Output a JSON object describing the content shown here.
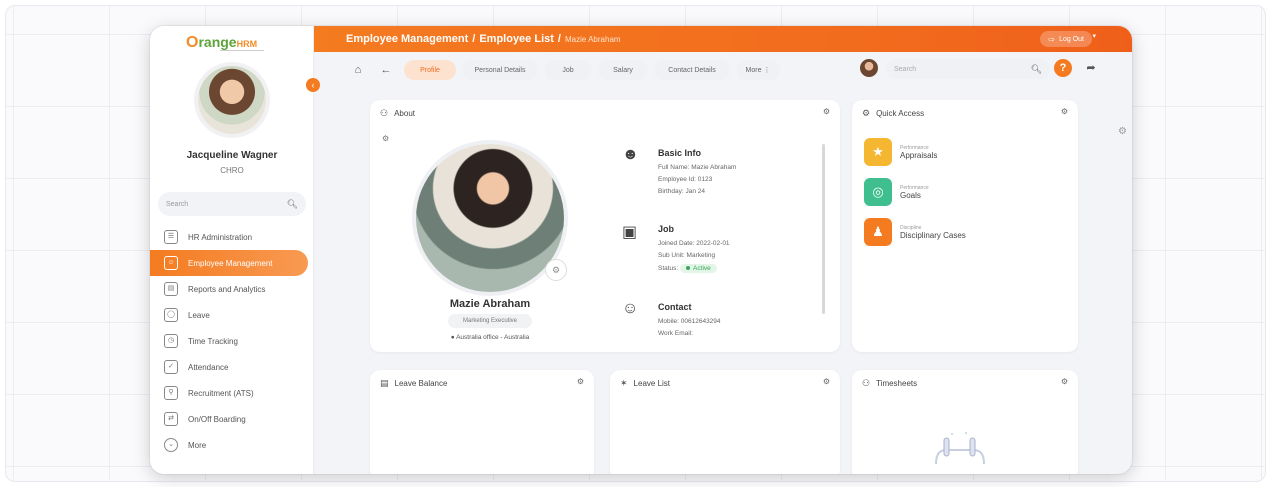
{
  "colors": {
    "accent": "#f47b20",
    "active_status": "#3ba55d"
  },
  "logo": {
    "brand_o": "O",
    "brand_rest": "range",
    "brand_hrm": "HRM"
  },
  "sidebar": {
    "user_name": "Jacqueline Wagner",
    "user_role": "CHRO",
    "search_placeholder": "Search",
    "items": [
      {
        "label": "HR Administration",
        "icon": "admin-icon"
      },
      {
        "label": "Employee Management",
        "icon": "people-icon",
        "active": true
      },
      {
        "label": "Reports and Analytics",
        "icon": "report-icon"
      },
      {
        "label": "Leave",
        "icon": "leave-icon"
      },
      {
        "label": "Time Tracking",
        "icon": "time-icon"
      },
      {
        "label": "Attendance",
        "icon": "attendance-icon"
      },
      {
        "label": "Recruitment (ATS)",
        "icon": "recruitment-icon"
      },
      {
        "label": "On/Off Boarding",
        "icon": "boarding-icon"
      },
      {
        "label": "More",
        "icon": "chevron-down-icon"
      }
    ]
  },
  "header": {
    "breadcrumb_1": "Employee Management",
    "breadcrumb_2": "Employee List",
    "breadcrumb_3": "Mazie Abraham",
    "logout_label": "Log Out"
  },
  "tabs": [
    {
      "label": "Profile",
      "active": true
    },
    {
      "label": "Personal Details"
    },
    {
      "label": "Job"
    },
    {
      "label": "Salary"
    },
    {
      "label": "Contact Details"
    },
    {
      "label": "More"
    }
  ],
  "top_search_placeholder": "Search",
  "about": {
    "title": "About",
    "name": "Mazie Abraham",
    "job_title": "Marketing Executive",
    "location": "Australia office - Australia",
    "basic_info": {
      "heading": "Basic Info",
      "full_name": "Full Name: Mazie Abraham",
      "employee_id": "Employee Id: 0123",
      "birthday": "Birthday: Jan 24"
    },
    "job": {
      "heading": "Job",
      "joined": "Joined Date: 2022-02-01",
      "sub_unit": "Sub Unit: Marketing",
      "status_label": "Status:",
      "status_value": "Active"
    },
    "contact": {
      "heading": "Contact",
      "mobile": "Mobile: 00612643294",
      "work_email": "Work Email:"
    }
  },
  "quick_access": {
    "title": "Quick Access",
    "items": [
      {
        "category": "Performance",
        "name": "Appraisals",
        "color": "#f5b731",
        "icon": "star-icon"
      },
      {
        "category": "Performance",
        "name": "Goals",
        "color": "#3fbf8f",
        "icon": "target-icon"
      },
      {
        "category": "Discipline",
        "name": "Disciplinary Cases",
        "color": "#f47b20",
        "icon": "person-icon"
      }
    ]
  },
  "widgets": {
    "leave_balance": "Leave Balance",
    "leave_list": "Leave List",
    "timesheets": "Timesheets"
  }
}
